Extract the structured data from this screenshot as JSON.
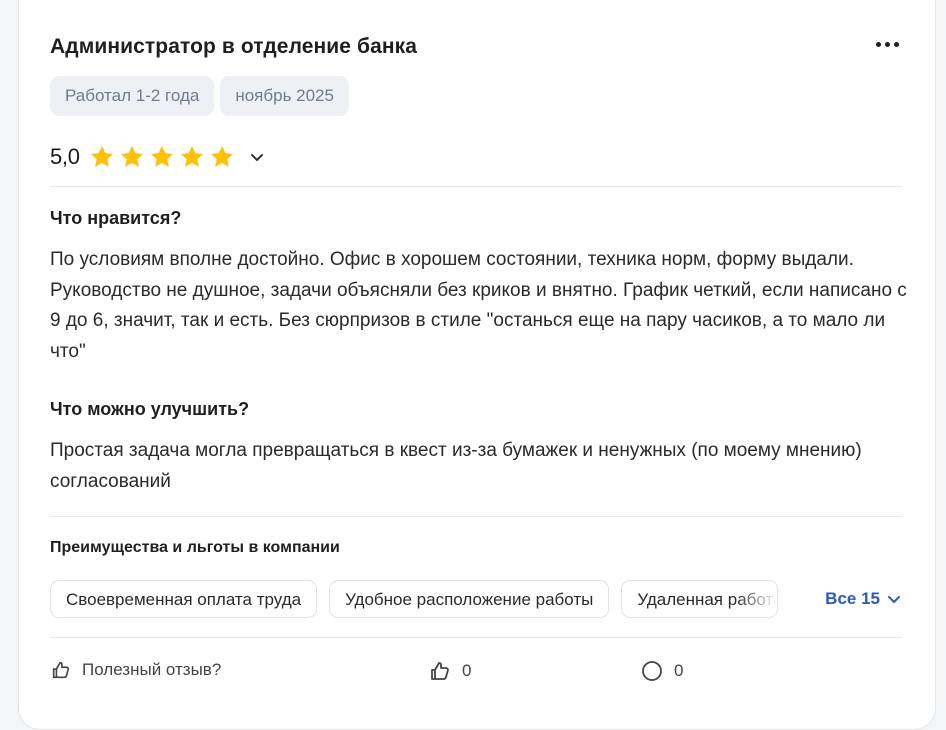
{
  "review": {
    "title": "Администратор в отделение банка",
    "tags": [
      "Работал 1-2 года",
      "ноябрь 2025"
    ],
    "rating": {
      "value": "5,0",
      "stars": 5,
      "star_color": "#ffc107"
    },
    "likes": {
      "heading": "Что нравится?",
      "text": "По условиям вполне достойно. Офис в хорошем состоянии, техника норм, форму выдали. Руководство не душное, задачи объясняли без криков и внятно. График четкий, если написано с 9 до 6, значит, так и есть. Без сюрпризов в стиле \"останься еще на пару часиков, а то мало ли что\""
    },
    "improve": {
      "heading": "Что можно улучшить?",
      "text": "Простая задача могла превращаться в квест из-за бумажек и ненужных (по моему мнению) согласований"
    },
    "benefits": {
      "heading": "Преимущества и льготы в компании",
      "chips": [
        "Своевременная оплата труда",
        "Удобное расположение работы",
        "Удаленная работа"
      ],
      "all_label": "Все 15"
    },
    "footer": {
      "helpful_label": "Полезный отзыв?",
      "likes_count": "0",
      "comments_count": "0"
    }
  },
  "colors": {
    "accent": "#2b5bb8",
    "tag_bg": "#edf0f5",
    "tag_text": "#6f7c8f"
  }
}
